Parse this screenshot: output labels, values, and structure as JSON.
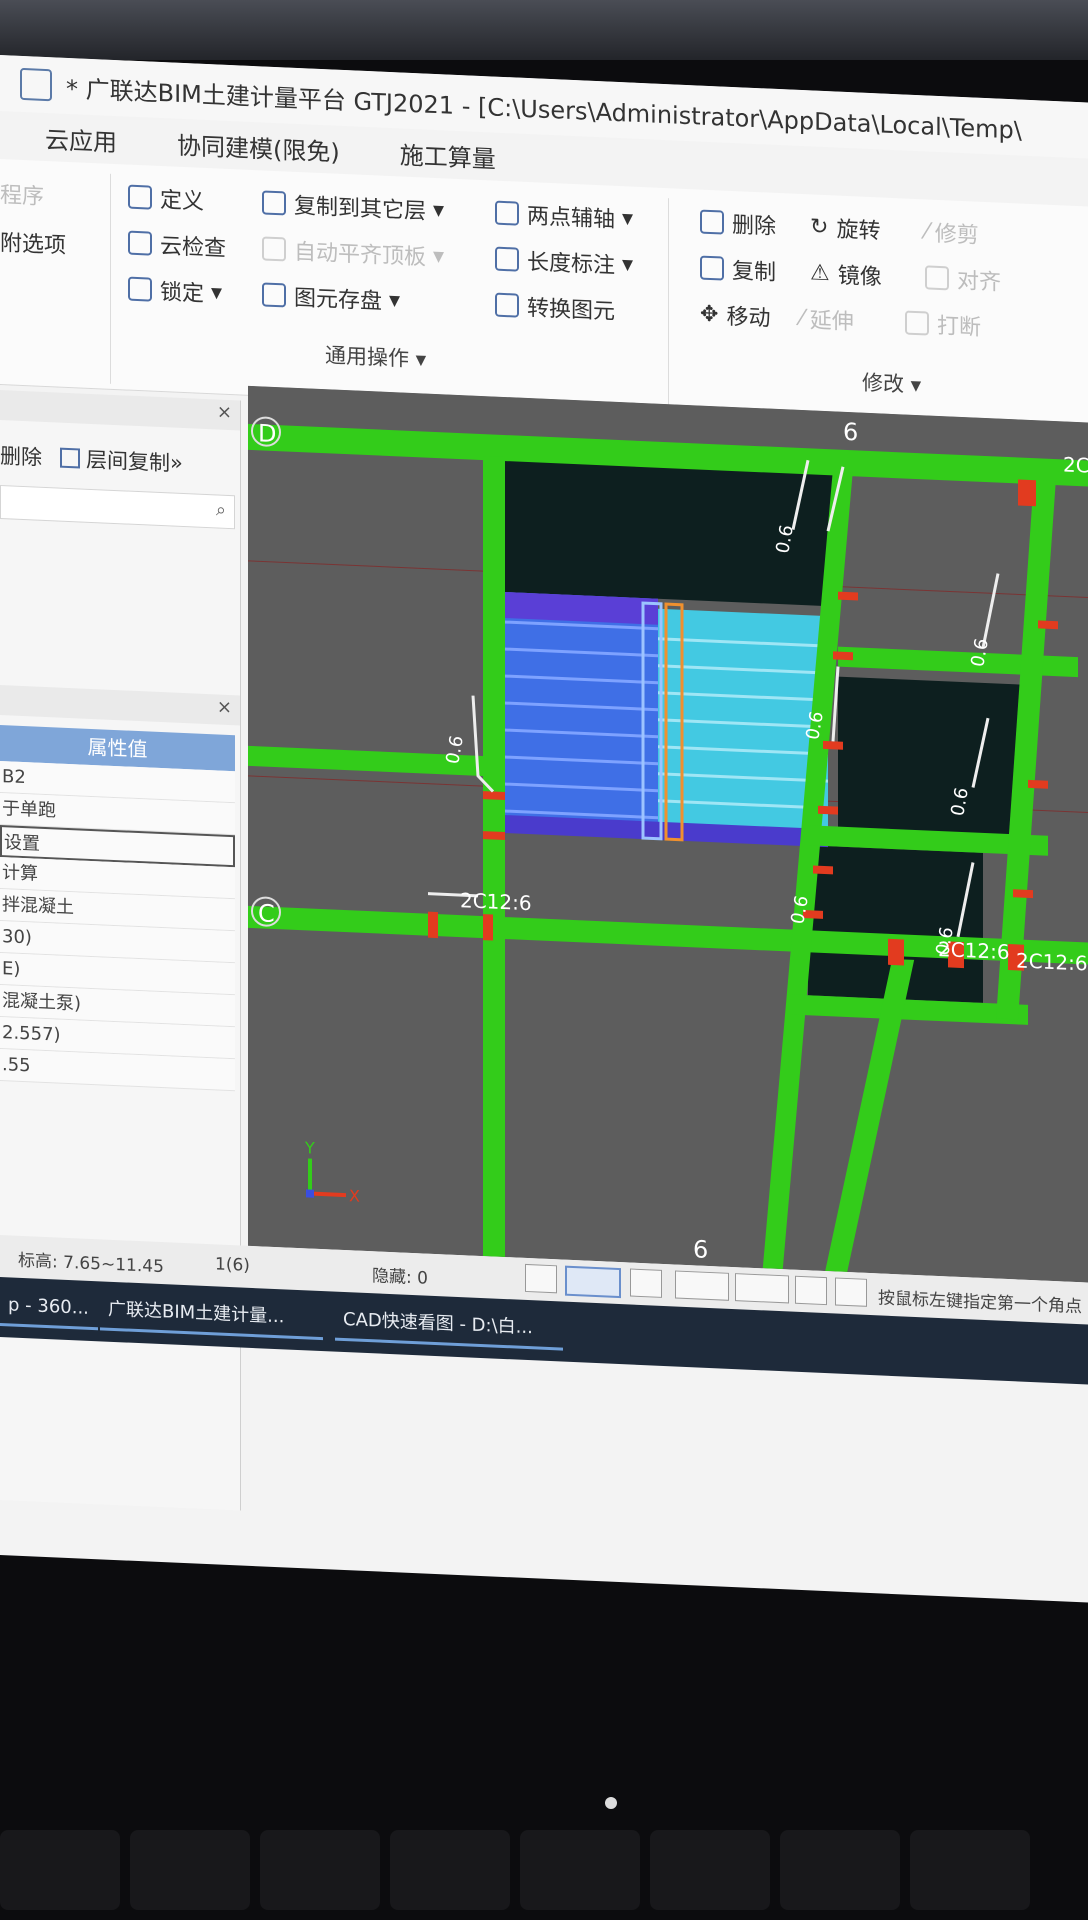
{
  "window": {
    "title": "* 广联达BIM土建计量平台 GTJ2021 - [C:\\Users\\Administrator\\AppData\\Local\\Temp\\"
  },
  "tabs": [
    "云应用",
    "协同建模(限免)",
    "施工算量"
  ],
  "ribbon": {
    "left_partial": [
      "程序",
      "附选项"
    ],
    "general": {
      "define": "定义",
      "cloud_check": "云检查",
      "lock": "锁定",
      "copy_to_floor": "复制到其它层",
      "auto_align": "自动平齐顶板",
      "save_element": "图元存盘",
      "two_point_axis": "两点辅轴",
      "length_dim": "长度标注",
      "convert_element": "转换图元",
      "group_label": "通用操作"
    },
    "modify": {
      "delete": "删除",
      "rotate": "旋转",
      "trim": "修剪",
      "copy": "复制",
      "mirror": "镜像",
      "align": "对齐",
      "move": "移动",
      "extend": "延伸",
      "break": "打断",
      "group_label": "修改"
    }
  },
  "left_panel": {
    "toolbar": [
      "删除",
      "层间复制"
    ],
    "attr_header": "属性值",
    "attr_rows": [
      "B2",
      "于单跑",
      "设置",
      "计算",
      "拌混凝土",
      "30)",
      "E)",
      "混凝土泵)",
      "2.557)",
      ".55"
    ]
  },
  "viewport": {
    "axis_labels": [
      "D",
      "C",
      "6",
      "6"
    ],
    "rebar_labels": [
      "2C12:6",
      "2C12:6",
      "2C12:6",
      "2C12"
    ],
    "dim_labels": [
      "0.6",
      "0.6",
      "0.6",
      "0.6",
      "0.6",
      "0.6",
      "0.6"
    ],
    "axis_x": "X",
    "axis_y": "Y"
  },
  "statusbar": {
    "elevation": "标高: 7.65~11.45",
    "count": "1(6)",
    "hidden": "隐藏: 0",
    "hint": "按鼠标左键指定第一个角点"
  },
  "taskbar": [
    {
      "label": "p - 360..."
    },
    {
      "label": "广联达BIM土建计量..."
    },
    {
      "label": "CAD快速看图 - D:\\白..."
    }
  ],
  "colors": {
    "beam_green": "#33cc1a",
    "rebar_red": "#e23b1f",
    "slab_dark": "#0d1f1f",
    "stair_blue": "#3f6fe6",
    "stair_cyan": "#43c9e2",
    "canvas_grey": "#5d5d5d"
  }
}
